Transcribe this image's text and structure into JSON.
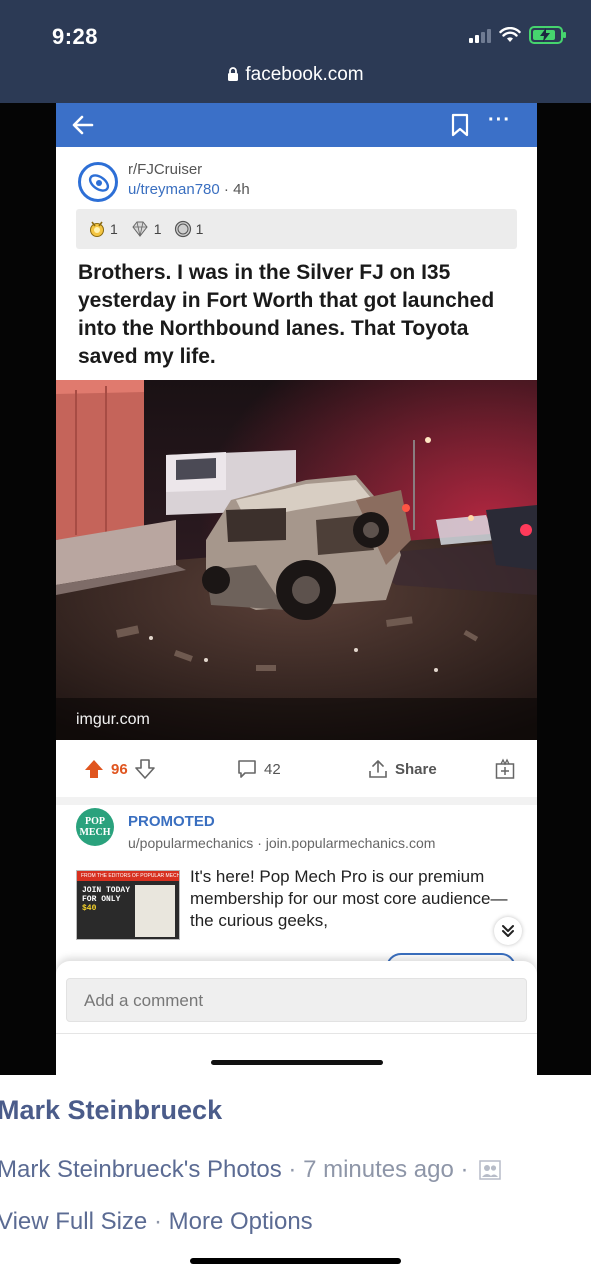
{
  "status_bar": {
    "time": "9:28",
    "battery_state": "charging"
  },
  "browser": {
    "url": "facebook.com"
  },
  "reddit_post": {
    "subreddit": "r/FJCruiser",
    "author": "u/treyman780",
    "separator": "·",
    "age": "4h",
    "awards": [
      {
        "icon": "medal-award-icon",
        "count": "1"
      },
      {
        "icon": "gem-award-icon",
        "count": "1"
      },
      {
        "icon": "coin-award-icon",
        "count": "1"
      }
    ],
    "title": "Brothers. I was in the Silver FJ on I35 yesterday in Fort Worth that got launched into the Northbound lanes. That Toyota saved my life.",
    "image_source": "imgur.com",
    "votes": "96",
    "comments": "42",
    "share_label": "Share"
  },
  "promoted": {
    "label": "PROMOTED",
    "logo_text": "POP MECH",
    "advertiser": "u/popularmechanics",
    "domain": "join.popularmechanics.com",
    "thumbnail": {
      "header": "FROM THE EDITORS OF POPULAR MECHANICS",
      "line1": "JOIN TODAY",
      "line2": "FOR ONLY",
      "price": "$40"
    },
    "body": "It's here! Pop Mech Pro is our premium membership for our most core audience—the curious geeks,"
  },
  "comment": {
    "placeholder": "Add a comment"
  },
  "facebook": {
    "poster": "Mark Steinbrueck",
    "album": "Mark Steinbrueck's Photos",
    "time_ago": "7 minutes ago",
    "dot": "·",
    "view_full_size": "View Full Size",
    "more_options": "More Options"
  },
  "colors": {
    "fb_chrome": "#2c3a55",
    "reddit_blue": "#3b70c8",
    "upvote_orange": "#e0551f",
    "popmech_green": "#2aa27d",
    "fb_link": "#4b5c8a"
  }
}
